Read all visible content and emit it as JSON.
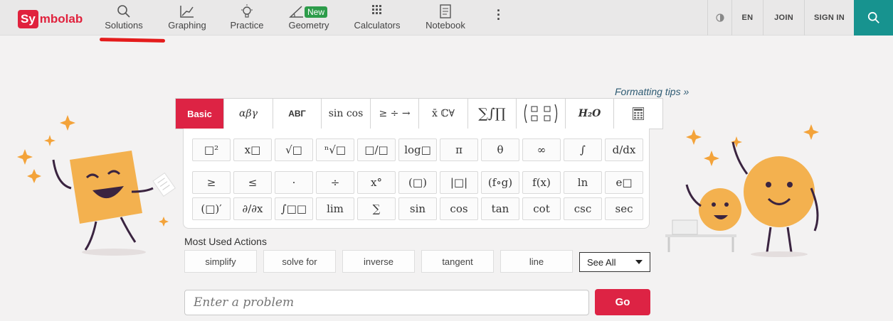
{
  "nav": {
    "logo_badge": "Sy",
    "logo_rest": "mbolab",
    "items": [
      {
        "label": "Solutions",
        "icon": "search-icon"
      },
      {
        "label": "Graphing",
        "icon": "graph-icon"
      },
      {
        "label": "Practice",
        "icon": "lightbulb-icon"
      },
      {
        "label": "Geometry",
        "icon": "angle-icon"
      },
      {
        "label": "Calculators",
        "icon": "calculator-icon"
      },
      {
        "label": "Notebook",
        "icon": "notebook-icon"
      }
    ],
    "new_badge": "New",
    "lang": "EN",
    "join": "JOIN",
    "signin": "SIGN IN"
  },
  "editor": {
    "formatting_tips": "Formatting tips »",
    "tabs": [
      "Basic",
      "αβγ",
      "ΑΒΓ",
      "sin cos",
      "≥ ÷ →",
      "x̄ ℂ∀",
      "∑∫∏",
      "",
      "H₂O",
      ""
    ],
    "keys_row1": [
      "□²",
      "x□",
      "√□",
      "ⁿ√□",
      "□/□",
      "log□",
      "π",
      "θ",
      "∞",
      "∫",
      "d/dx"
    ],
    "keys_row2": [
      "≥",
      "≤",
      "·",
      "÷",
      "x°",
      "(□)",
      "|□|",
      "(f∘g)",
      "f(x)",
      "ln",
      "e□"
    ],
    "keys_row3": [
      "(□)′",
      "∂/∂x",
      "∫□□",
      "lim",
      "∑",
      "sin",
      "cos",
      "tan",
      "cot",
      "csc",
      "sec"
    ]
  },
  "actions": {
    "title": "Most Used Actions",
    "items": [
      "simplify",
      "solve for",
      "inverse",
      "tangent",
      "line"
    ],
    "see_all": "See All"
  },
  "input": {
    "placeholder": "Enter a problem",
    "go": "Go"
  },
  "colors": {
    "brand": "#e0223d",
    "teal": "#17938f",
    "new": "#2d9c4a"
  }
}
